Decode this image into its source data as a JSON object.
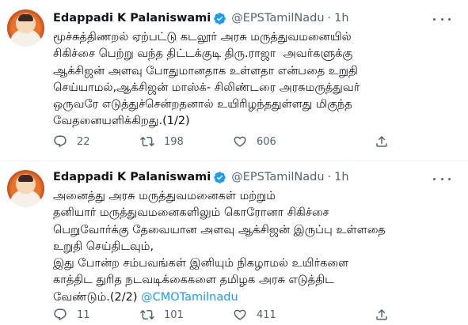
{
  "tweets": [
    {
      "author_name": "Edappadi K Palaniswami",
      "handle": "@EPSTamilNadu",
      "separator": "·",
      "time": "1h",
      "text": "மூச்சுத்திணறல் ஏற்பட்டு கடலூர் அரசு மருத்துவமனையில்\nசிகிச்சை பெற்று வந்த திட்டக்குடி திரு.ராஜா  அவர்களுக்கு\nஆக்சிஜன் அளவு போதுமானதாக உள்ளதா என்பதை உறுதி\nசெய்யாமல்,ஆக்சிஜன் மாஸ்க்- சிலிண்டரை அரசுமருத்துவர்\nஒருவரே எடுத்துச்சென்றதனால் உயிரிழந்ததுள்ளது மிகுந்த\nவேதனையளிக்கிறது.(1/2)",
      "mention": "",
      "replies": "22",
      "retweets": "198",
      "likes": "606"
    },
    {
      "author_name": "Edappadi K Palaniswami",
      "handle": "@EPSTamilNadu",
      "separator": "·",
      "time": "1h",
      "text": "அனைத்து அரசு மருத்துவமனைகள் மற்றும்\nதனியார் மருத்துவமனைகளிலும் கொரோனா சிகிச்சை\nபெறுவோர்க்கு தேவையான அளவு ஆக்சிஜன் இருப்பு உள்ளதை\nஉறுதி செய்திடவும்,\nஇது போன்ற சம்பவங்கள் இனியும் நிகழாமல் உயிர்களை\nகாத்திட துரித நடவடிக்கைகளை தமிழக அரசு எடுத்திட\nவேண்டும்.(2/2) ",
      "mention": "@CMOTamilnadu",
      "replies": "11",
      "retweets": "101",
      "likes": "411"
    }
  ],
  "icons": {
    "verified": "verified-badge-icon",
    "more": "more-options-icon",
    "reply": "reply-icon",
    "retweet": "retweet-icon",
    "like": "heart-icon",
    "share": "share-icon"
  },
  "colors": {
    "text": "#0f1419",
    "secondary": "#536471",
    "accent": "#1d9bf0",
    "divider": "#eff3f4"
  }
}
